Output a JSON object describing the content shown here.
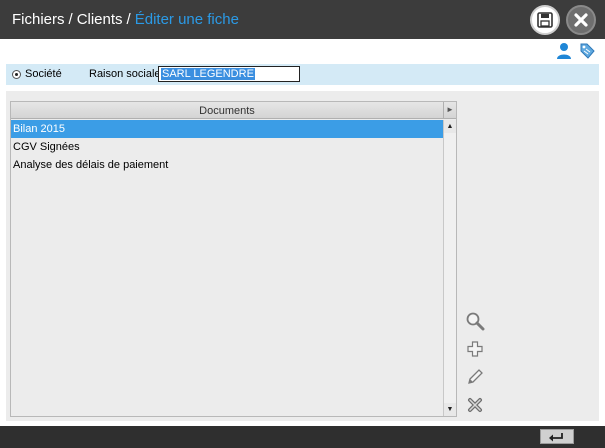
{
  "header": {
    "breadcrumb": [
      "Fichiers",
      "Clients"
    ],
    "current": "Éditer une fiche",
    "separator": "/"
  },
  "icons": {
    "save": "floppy-disk-icon",
    "close": "close-icon",
    "user": "user-icon",
    "tag": "tag-icon",
    "search": "magnifier-icon",
    "add": "plus-icon",
    "edit": "pencil-icon",
    "delete": "cross-icon",
    "back": "return-arrow-icon"
  },
  "form": {
    "radio_label": "Société",
    "raison_sociale_label": "Raison sociale",
    "raison_sociale_value": "SARL LEGENDRE"
  },
  "documents": {
    "header": "Documents",
    "items": [
      "Bilan 2015",
      "CGV Signées",
      "Analyse des délais de paiement"
    ],
    "selected_index": 0
  },
  "colors": {
    "titlebar": "#3c3c3c",
    "accent": "#2b9ae6",
    "selection": "#3b9de6",
    "form_row": "#d4eaf6"
  }
}
